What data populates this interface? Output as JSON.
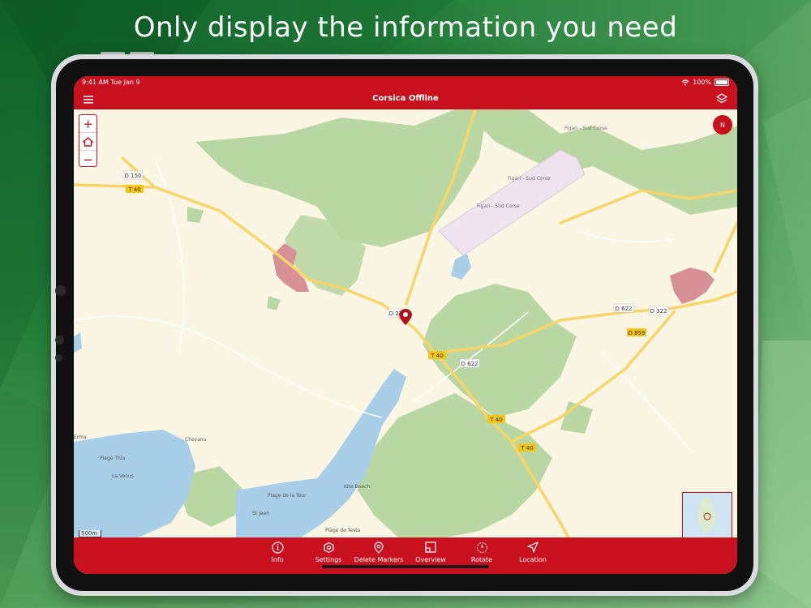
{
  "headline": "Only display the information you need",
  "status_bar": {
    "time": "9:41 AM  Tue Jan 9",
    "battery": "100%"
  },
  "nav": {
    "title": "Corsica Offline"
  },
  "map_labels": {
    "d150": "D 150",
    "t40_a": "T 40",
    "t40_b": "T 40",
    "t40_c": "T 40",
    "t40_d": "T 40",
    "d22": "D 22",
    "d622_a": "D 622",
    "d622_b": "D 622",
    "d322": "D 322",
    "d859": "D 859",
    "airport_1": "Figari - Sud Corse",
    "airport_2": "Figari - Sud Corse",
    "airport_3": "Figari - Sud Corse",
    "place_chevanu": "Chevanu",
    "place_erma": "Erma",
    "place_plage_thia": "Plage Thia",
    "place_la_venus": "La Venus",
    "place_plage_tour": "Plage de la Tour",
    "place_kite_beach": "Kite Beach",
    "place_st_jean": "St Jean",
    "place_plage_testa": "Plage de Testa"
  },
  "scale": "500m",
  "compass": "N",
  "tabs": [
    {
      "label": "Info",
      "icon": "info-icon"
    },
    {
      "label": "Settings",
      "icon": "settings-icon"
    },
    {
      "label": "Delete Markers",
      "icon": "marker-icon"
    },
    {
      "label": "Overview",
      "icon": "overview-icon"
    },
    {
      "label": "Rotate",
      "icon": "rotate-icon"
    },
    {
      "label": "Location",
      "icon": "location-arrow-icon"
    }
  ],
  "colors": {
    "brand_red": "#c8101e",
    "map_background": "#fbf6e4",
    "forest_green": "#b9d7a2",
    "water_blue": "#a9cfe8",
    "road_yellow": "#f7d56a"
  }
}
